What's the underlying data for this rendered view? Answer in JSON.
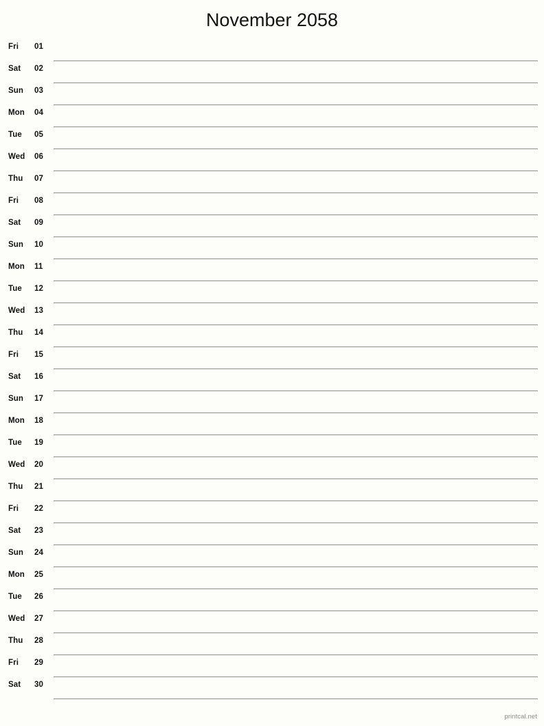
{
  "header": {
    "title": "November 2058"
  },
  "calendar": {
    "month": "November",
    "year": "2058",
    "days": [
      {
        "weekday": "Fri",
        "date": "01"
      },
      {
        "weekday": "Sat",
        "date": "02"
      },
      {
        "weekday": "Sun",
        "date": "03"
      },
      {
        "weekday": "Mon",
        "date": "04"
      },
      {
        "weekday": "Tue",
        "date": "05"
      },
      {
        "weekday": "Wed",
        "date": "06"
      },
      {
        "weekday": "Thu",
        "date": "07"
      },
      {
        "weekday": "Fri",
        "date": "08"
      },
      {
        "weekday": "Sat",
        "date": "09"
      },
      {
        "weekday": "Sun",
        "date": "10"
      },
      {
        "weekday": "Mon",
        "date": "11"
      },
      {
        "weekday": "Tue",
        "date": "12"
      },
      {
        "weekday": "Wed",
        "date": "13"
      },
      {
        "weekday": "Thu",
        "date": "14"
      },
      {
        "weekday": "Fri",
        "date": "15"
      },
      {
        "weekday": "Sat",
        "date": "16"
      },
      {
        "weekday": "Sun",
        "date": "17"
      },
      {
        "weekday": "Mon",
        "date": "18"
      },
      {
        "weekday": "Tue",
        "date": "19"
      },
      {
        "weekday": "Wed",
        "date": "20"
      },
      {
        "weekday": "Thu",
        "date": "21"
      },
      {
        "weekday": "Fri",
        "date": "22"
      },
      {
        "weekday": "Sat",
        "date": "23"
      },
      {
        "weekday": "Sun",
        "date": "24"
      },
      {
        "weekday": "Mon",
        "date": "25"
      },
      {
        "weekday": "Tue",
        "date": "26"
      },
      {
        "weekday": "Wed",
        "date": "27"
      },
      {
        "weekday": "Thu",
        "date": "28"
      },
      {
        "weekday": "Fri",
        "date": "29"
      },
      {
        "weekday": "Sat",
        "date": "30"
      }
    ]
  },
  "footer": {
    "credit": "printcal.net"
  },
  "colors": {
    "background": "#fdfdfa",
    "text": "#111111",
    "rule": "#8d8f89",
    "footer_text": "#8a8a8a"
  }
}
